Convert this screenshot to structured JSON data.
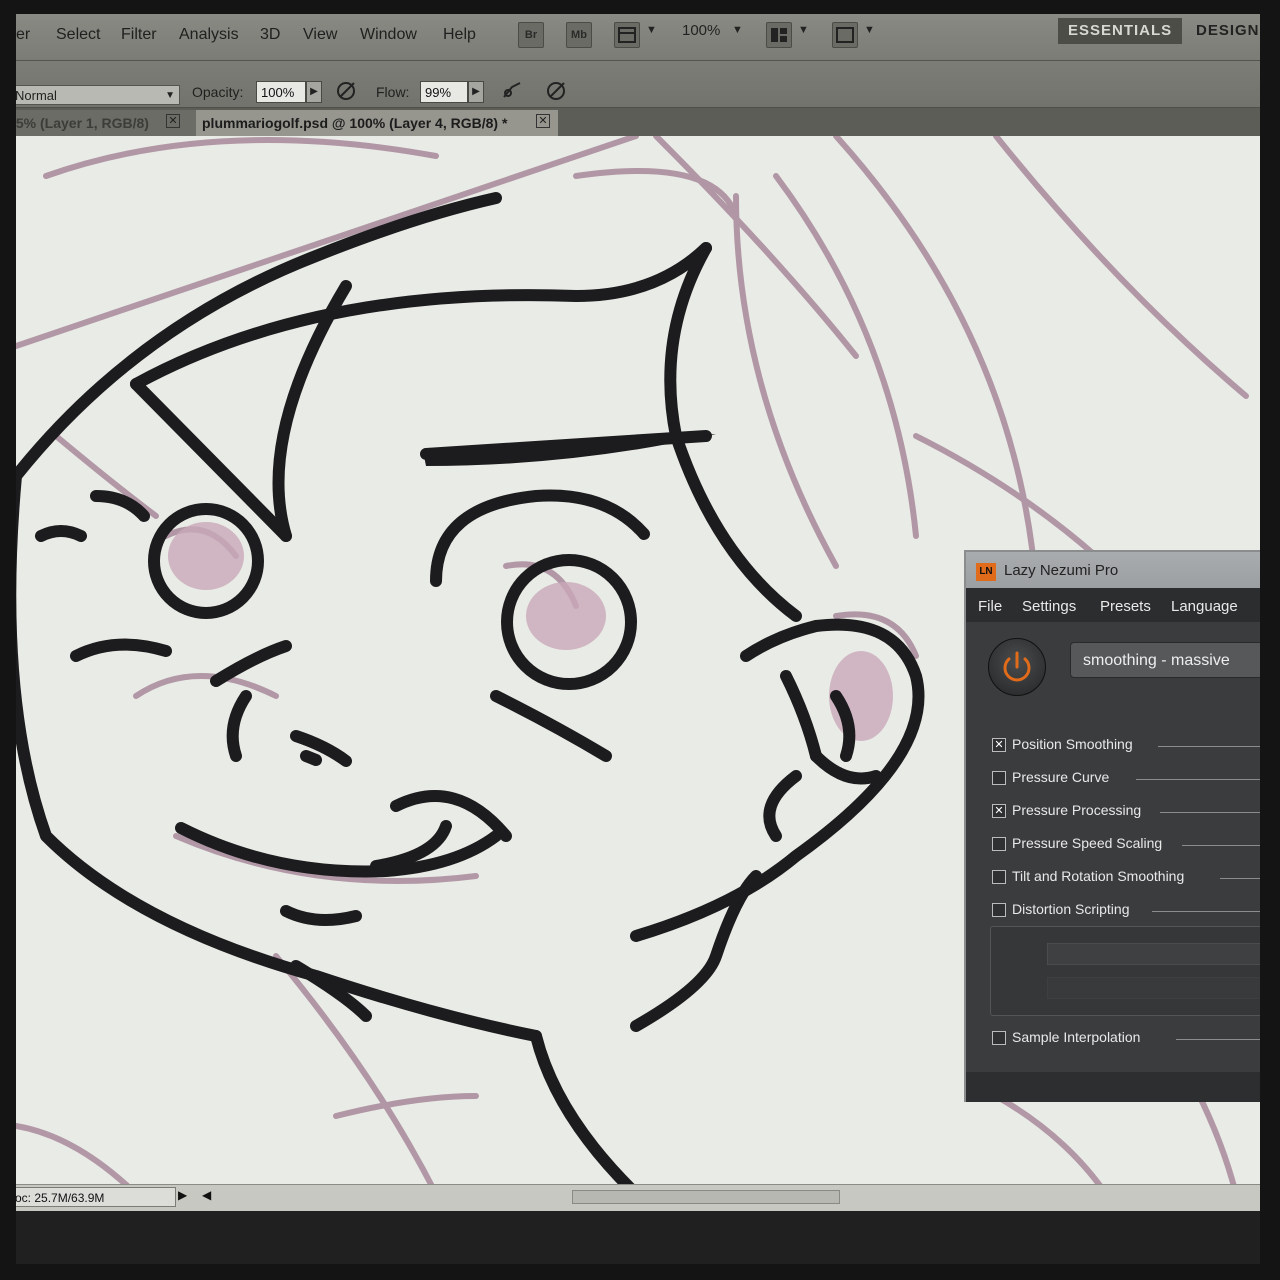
{
  "menubar": {
    "items": [
      "er",
      "Select",
      "Filter",
      "Analysis",
      "3D",
      "View",
      "Window",
      "Help"
    ],
    "buttons": [
      "Br",
      "Mb"
    ],
    "zoom": "100%",
    "workspaces": [
      "ESSENTIALS",
      "DESIGN"
    ]
  },
  "options": {
    "blend_mode": "Normal",
    "opacity_label": "Opacity:",
    "opacity_value": "100%",
    "flow_label": "Flow:",
    "flow_value": "99%"
  },
  "tabs": {
    "inactive": ".5% (Layer 1, RGB/8)",
    "active": "plummariogolf.psd @ 100% (Layer 4, RGB/8) *"
  },
  "status": {
    "doc_size": "oc: 25.7M/63.9M"
  },
  "lazy_nezumi": {
    "title": "Lazy Nezumi Pro",
    "logo": "LN",
    "menu": [
      "File",
      "Settings",
      "Presets",
      "Language"
    ],
    "preset": "smoothing - massive",
    "options": [
      {
        "label": "Position Smoothing",
        "checked": true
      },
      {
        "label": "Pressure Curve",
        "checked": false
      },
      {
        "label": "Pressure Processing",
        "checked": true
      },
      {
        "label": "Pressure Speed Scaling",
        "checked": false
      },
      {
        "label": "Tilt and Rotation Smoothing",
        "checked": false
      },
      {
        "label": "Distortion Scripting",
        "checked": false
      }
    ],
    "sample_interpolation": {
      "label": "Sample Interpolation",
      "checked": false
    },
    "checked_mark": "✕"
  },
  "colors": {
    "canvas": "#e9ebe6",
    "sketch": "#a8899a",
    "ink": "#1c1c1e",
    "accent_power": "#e06b1a"
  }
}
